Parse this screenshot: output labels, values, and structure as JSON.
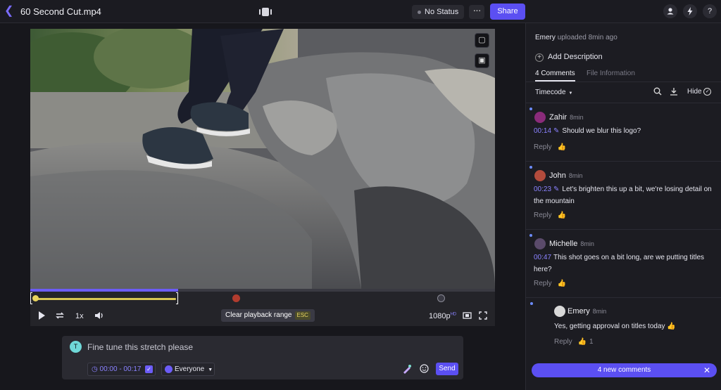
{
  "header": {
    "back_icon": "chevron-left-icon",
    "filename": "60 Second Cut.mp4",
    "status_label": "No Status",
    "more_label": "···",
    "share_label": "Share",
    "accent": "#5b4ff2"
  },
  "player": {
    "speed": "1x",
    "clear_range_label": "Clear playback range",
    "esc_label": "ESC",
    "quality": "1080p",
    "quality_badge": "HD"
  },
  "composer": {
    "avatar_initial": "T",
    "text": "Fine tune this stretch please",
    "time_range": "00:00 - 00:17",
    "audience": "Everyone",
    "send_label": "Send"
  },
  "panel": {
    "uploader": "Emery",
    "uploaded_text": "uploaded 8min ago",
    "add_description": "Add Description",
    "tabs": [
      "4 Comments",
      "File Information"
    ],
    "sort_label": "Timecode",
    "hide_label": "Hide",
    "new_comments_label": "4 new comments"
  },
  "comments": [
    {
      "author": "Zahir",
      "age": "8min",
      "timecode": "00:14",
      "text": "Should we blur this logo?",
      "reply": "Reply",
      "likes": ""
    },
    {
      "author": "John",
      "age": "8min",
      "timecode": "00:23",
      "text": "Let's brighten this up a bit, we're losing detail on the mountain",
      "reply": "Reply",
      "likes": ""
    },
    {
      "author": "Michelle",
      "age": "8min",
      "timecode": "00:47",
      "text": "This shot goes on a bit long, are we putting titles here?",
      "reply": "Reply",
      "likes": ""
    },
    {
      "author": "Emery",
      "age": "8min",
      "timecode": "",
      "text": "Yes, getting approval on titles today 👍",
      "reply": "Reply",
      "likes": "1"
    }
  ]
}
